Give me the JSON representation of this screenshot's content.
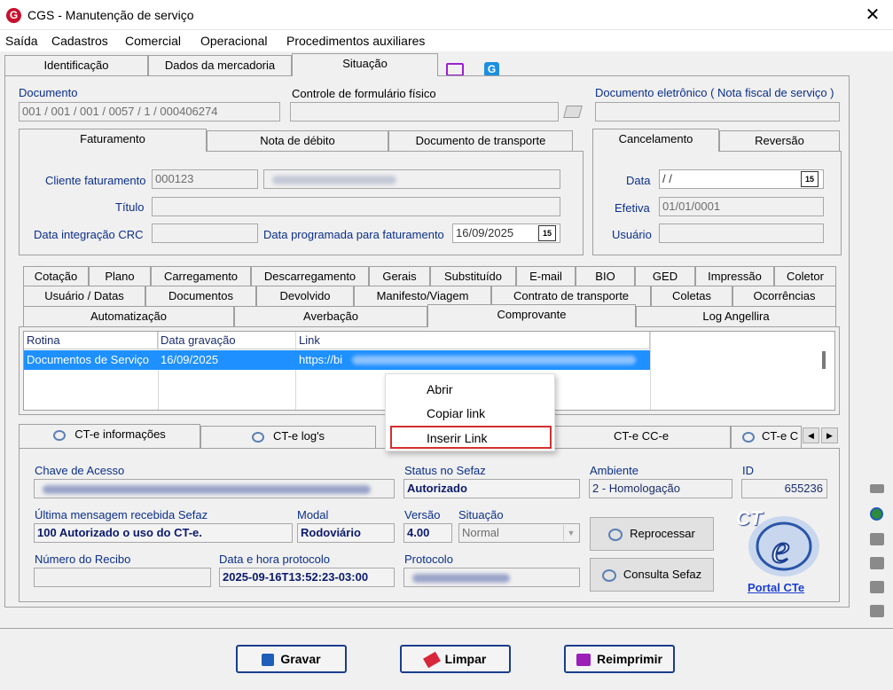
{
  "window": {
    "title": "CGS - Manutenção de serviço",
    "close": "✕"
  },
  "menu": [
    "Saída",
    "Cadastros",
    "Comercial",
    "Operacional",
    "Procedimentos auxiliares"
  ],
  "main_tabs": [
    "Identificação",
    "Dados da mercadoria",
    "Situação"
  ],
  "doc": {
    "documento_label": "Documento",
    "documento_value": "001 / 001 / 001 / 0057 / 1 / 000406274",
    "controle_label": "Controle de formulário físico",
    "eletronico_label": "Documento eletrônico ( Nota fiscal de serviço )"
  },
  "fat_tabs": [
    "Faturamento",
    "Nota de débito",
    "Documento de transporte"
  ],
  "fat": {
    "cliente_label": "Cliente faturamento",
    "cliente_code": "000123",
    "titulo_label": "Título",
    "crc_label": "Data integração CRC",
    "prog_label": "Data programada para faturamento",
    "prog_value": "16/09/2025",
    "cal_icon": "15"
  },
  "cancel_tabs": [
    "Cancelamento",
    "Reversão"
  ],
  "cancel": {
    "data_label": "Data",
    "data_value": " /  /",
    "efetiva_label": "Efetiva",
    "efetiva_value": "01/01/0001",
    "usuario_label": "Usuário"
  },
  "tabs_row1": [
    "Cotação",
    "Plano",
    "Carregamento",
    "Descarregamento",
    "Gerais",
    "Substituído",
    "E-mail",
    "BIO",
    "GED",
    "Impressão",
    "Coletor"
  ],
  "tabs_row2": [
    "Usuário / Datas",
    "Documentos",
    "Devolvido",
    "Manifesto/Viagem",
    "Contrato de transporte",
    "Coletas",
    "Ocorrências"
  ],
  "tabs_row3": [
    "Automatização",
    "Averbação",
    "Comprovante",
    "Log Angellira"
  ],
  "grid": {
    "headers": [
      "Rotina",
      "Data gravação",
      "Link"
    ],
    "rows": [
      {
        "rotina": "Documentos de Serviço",
        "data": "16/09/2025",
        "link": "https://bi"
      }
    ]
  },
  "context_menu": [
    "Abrir",
    "Copiar link",
    "Inserir Link"
  ],
  "cte_tabs": [
    "CT-e informações",
    "CT-e log's",
    "CT-e CC-e",
    "CT-e C"
  ],
  "cte": {
    "chave_label": "Chave de Acesso",
    "status_label": "Status no Sefaz",
    "status_value": "Autorizado",
    "ambiente_label": "Ambiente",
    "ambiente_value": "2 - Homologação",
    "id_label": "ID",
    "id_value": "655236",
    "msg_label": "Última mensagem recebida Sefaz",
    "msg_value": "100 Autorizado o uso do CT-e.",
    "modal_label": "Modal",
    "modal_value": "Rodoviário",
    "versao_label": "Versão",
    "versao_value": "4.00",
    "situacao_label": "Situação",
    "situacao_value": "Normal",
    "recibo_label": "Número do Recibo",
    "protocolo_dt_label": "Data e hora protocolo",
    "protocolo_dt_value": "2025-09-16T13:52:23-03:00",
    "protocolo_label": "Protocolo",
    "reprocessar": "Reprocessar",
    "consulta": "Consulta Sefaz",
    "portal": "Portal CTe",
    "logo_text": "CT"
  },
  "footer": {
    "gravar": "Gravar",
    "limpar": "Limpar",
    "reimprimir": "Reimprimir"
  }
}
